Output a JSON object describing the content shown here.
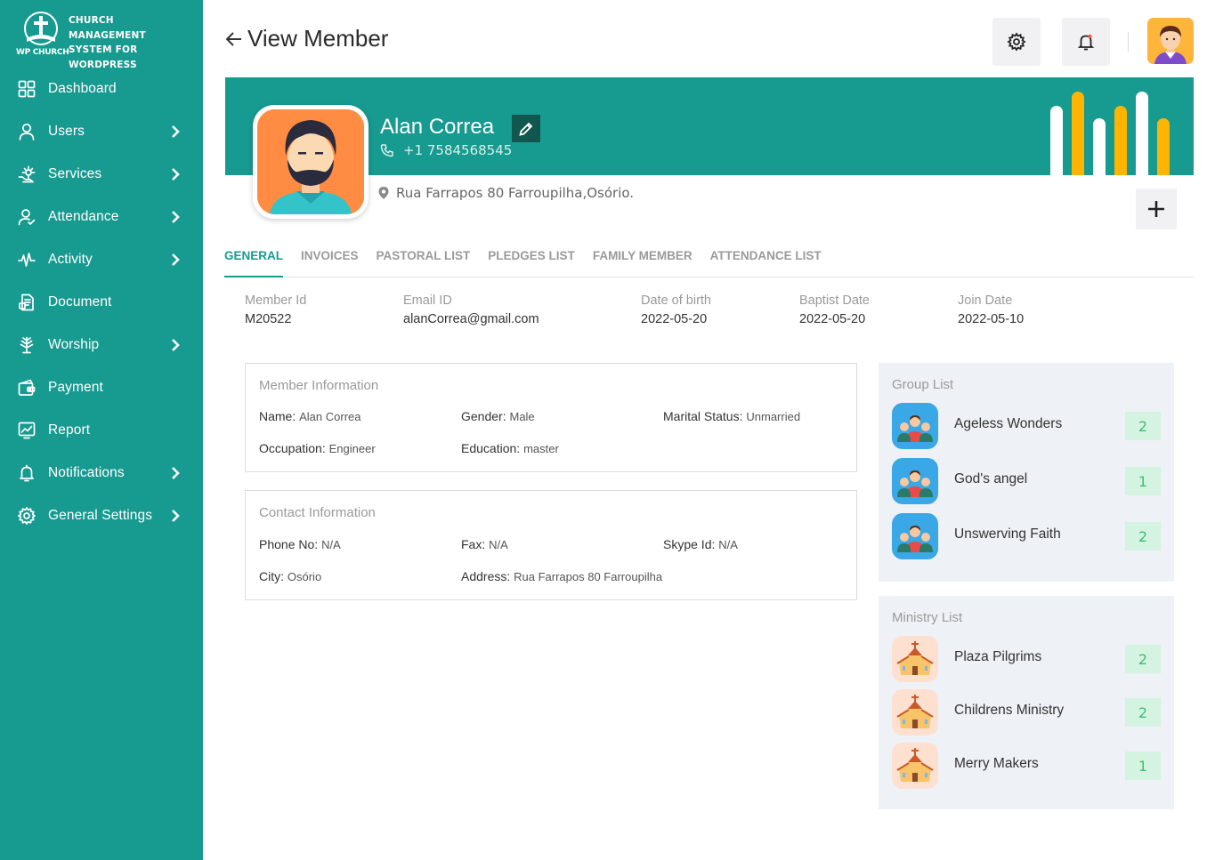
{
  "brand": {
    "logo_text": "WP CHURCH",
    "lines": [
      "CHURCH MANAGEMENT",
      "SYSTEM FOR",
      "WORDPRESS"
    ]
  },
  "sidebar": {
    "items": [
      {
        "label": "Dashboard",
        "icon": "dashboard-icon",
        "has_children": false
      },
      {
        "label": "Users",
        "icon": "user-icon",
        "has_children": true
      },
      {
        "label": "Services",
        "icon": "services-icon",
        "has_children": true
      },
      {
        "label": "Attendance",
        "icon": "attendance-icon",
        "has_children": true
      },
      {
        "label": "Activity",
        "icon": "activity-icon",
        "has_children": true
      },
      {
        "label": "Document",
        "icon": "document-icon",
        "has_children": false
      },
      {
        "label": "Worship",
        "icon": "worship-icon",
        "has_children": true
      },
      {
        "label": "Payment",
        "icon": "payment-icon",
        "has_children": false
      },
      {
        "label": "Report",
        "icon": "report-icon",
        "has_children": false
      },
      {
        "label": "Notifications",
        "icon": "bell-icon",
        "has_children": true
      },
      {
        "label": "General Settings",
        "icon": "gear-icon",
        "has_children": true
      }
    ]
  },
  "header": {
    "title": "View Member"
  },
  "member": {
    "name": "Alan Correa",
    "phone": "+1 7584568545",
    "address": "Rua Farrapos 80 Farroupilha,Osório."
  },
  "tabs": [
    "GENERAL",
    "INVOICES",
    "PASTORAL LIST",
    "PLEDGES LIST",
    "FAMILY MEMBER",
    "ATTENDANCE LIST"
  ],
  "summary": {
    "member_id": {
      "label": "Member Id",
      "value": "M20522"
    },
    "email": {
      "label": "Email ID",
      "value": "alanCorrea@gmail.com"
    },
    "dob": {
      "label": "Date of birth",
      "value": "2022-05-20"
    },
    "baptist": {
      "label": "Baptist Date",
      "value": "2022-05-20"
    },
    "join": {
      "label": "Join Date",
      "value": "2022-05-10"
    }
  },
  "member_info": {
    "title": "Member Information",
    "name": {
      "label": "Name:",
      "value": "Alan Correa"
    },
    "gender": {
      "label": "Gender:",
      "value": "Male"
    },
    "marital": {
      "label": "Marital Status:",
      "value": "Unmarried"
    },
    "occupation": {
      "label": "Occupation:",
      "value": "Engineer"
    },
    "education": {
      "label": "Education:",
      "value": "master"
    }
  },
  "contact_info": {
    "title": "Contact Information",
    "phone": {
      "label": "Phone No:",
      "value": "N/A"
    },
    "fax": {
      "label": "Fax:",
      "value": "N/A"
    },
    "skype": {
      "label": "Skype Id:",
      "value": "N/A"
    },
    "city": {
      "label": "City:",
      "value": "Osório"
    },
    "address": {
      "label": "Address:",
      "value": "Rua Farrapos 80 Farroupilha"
    }
  },
  "groups": {
    "title": "Group List",
    "items": [
      {
        "name": "Ageless Wonders",
        "count": "2"
      },
      {
        "name": "God's angel",
        "count": "1"
      },
      {
        "name": "Unswerving Faith",
        "count": "2"
      }
    ]
  },
  "ministries": {
    "title": "Ministry List",
    "items": [
      {
        "name": "Plaza Pilgrims",
        "count": "2"
      },
      {
        "name": "Childrens Ministry",
        "count": "2"
      },
      {
        "name": "Merry Makers",
        "count": "1"
      }
    ]
  },
  "colors": {
    "primary": "#179a8f",
    "accent": "#ffb400",
    "badge_bg": "#d5f3e1",
    "badge_text": "#3bbf74"
  }
}
